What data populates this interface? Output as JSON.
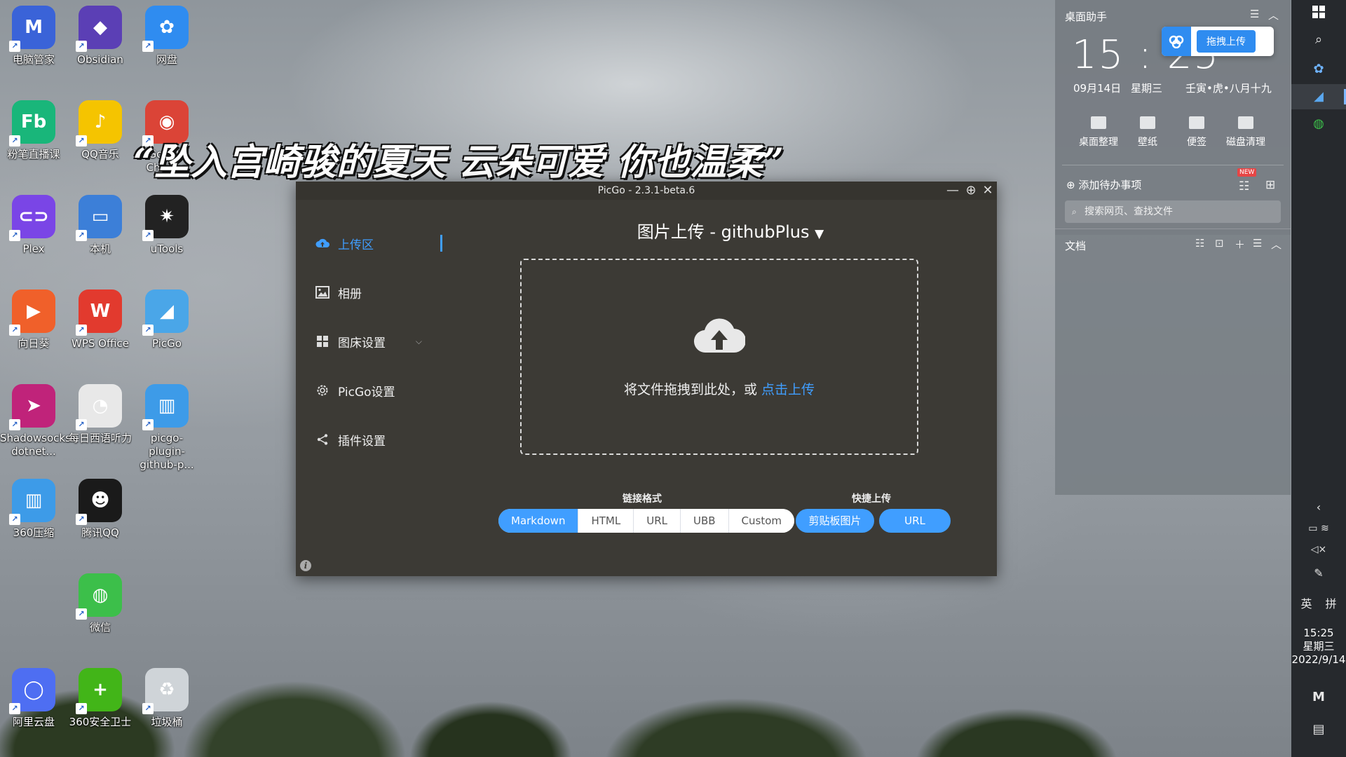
{
  "desktop": {
    "banner_text": "“坠入宫崎骏的夏天 云朵可爱 你也温柔”",
    "icons": [
      {
        "label": "电脑管家",
        "glyph": "M",
        "color": "#3a63d8"
      },
      {
        "label": "Obsidian",
        "glyph": "◆",
        "color": "#5b3fb5"
      },
      {
        "label": "网盘",
        "glyph": "✿",
        "color": "#2f8cf0"
      },
      {
        "label": "粉笔直播课",
        "glyph": "Fb",
        "color": "#19b67a"
      },
      {
        "label": "QQ音乐",
        "glyph": "♪",
        "color": "#f5c400"
      },
      {
        "label": "Google Chrome",
        "glyph": "◉",
        "color": "#db4437"
      },
      {
        "label": "Plex",
        "glyph": "⊂⊃",
        "color": "#7a45e6"
      },
      {
        "label": "本机",
        "glyph": "▭",
        "color": "#3c7fd8"
      },
      {
        "label": "uTools",
        "glyph": "✷",
        "color": "#222222"
      },
      {
        "label": "向日葵",
        "glyph": "▶",
        "color": "#f0602a"
      },
      {
        "label": "WPS Office",
        "glyph": "W",
        "color": "#e23a2e"
      },
      {
        "label": "PicGo",
        "glyph": "◢",
        "color": "#4aa6e8"
      },
      {
        "label": "Shadowsocks-dotnet...",
        "glyph": "➤",
        "color": "#c0237a"
      },
      {
        "label": "每日西语听力",
        "glyph": "◔",
        "color": "#e8e8e8"
      },
      {
        "label": "picgo-plugin-github-p...",
        "glyph": "▥",
        "color": "#3d9be8"
      },
      {
        "label": "360压缩",
        "glyph": "▥",
        "color": "#3d9be8"
      },
      {
        "label": "腾讯QQ",
        "glyph": "☻",
        "color": "#1a1a1a"
      },
      {
        "label": "微信",
        "glyph": "◍",
        "color": "#3cbf4a"
      },
      {
        "label": "阿里云盘",
        "glyph": "◯",
        "color": "#4e6ef2"
      },
      {
        "label": "360安全卫士",
        "glyph": "+",
        "color": "#42b518"
      },
      {
        "label": "垃圾桶",
        "glyph": "♻",
        "color": "#cfd4d8"
      }
    ]
  },
  "picgo": {
    "title": "PicGo - 2.3.1-beta.6",
    "sidebar": [
      {
        "label": "上传区",
        "icon": "cloud-upload-icon"
      },
      {
        "label": "相册",
        "icon": "picture-icon"
      },
      {
        "label": "图床设置",
        "icon": "grid-icon"
      },
      {
        "label": "PicGo设置",
        "icon": "gear-icon"
      },
      {
        "label": "插件设置",
        "icon": "share-icon"
      }
    ],
    "upload_title": "图片上传 - githubPlus",
    "drop_text": "将文件拖拽到此处，或",
    "drop_link": "点击上传",
    "link_format_label": "链接格式",
    "link_formats": [
      "Markdown",
      "HTML",
      "URL",
      "UBB",
      "Custom"
    ],
    "selected_format": "Markdown",
    "quick_upload_label": "快捷上传",
    "quick_buttons": [
      "剪贴板图片",
      "URL"
    ],
    "accent": "#409eff"
  },
  "assistant": {
    "title": "桌面助手",
    "time": "15 : 25",
    "upload_float_label": "拖拽上传",
    "date": "09月14日",
    "weekday": "星期三",
    "lunar": "壬寅•虎•八月十九",
    "tools": [
      "桌面整理",
      "壁纸",
      "便签",
      "磁盘清理"
    ],
    "todo": "添加待办事项",
    "new_badge": "NEW",
    "search_placeholder": "搜索网页、查找文件",
    "docs_title": "文档"
  },
  "taskbar": {
    "ime": "英",
    "ime2": "拼",
    "clock_time": "15:25",
    "clock_weekday": "星期三",
    "clock_date": "2022/9/14"
  }
}
